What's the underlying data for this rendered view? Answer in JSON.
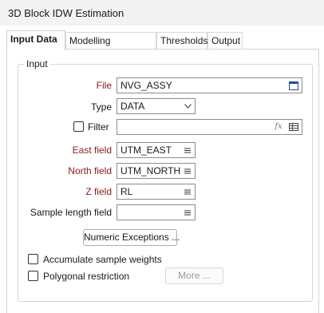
{
  "window": {
    "title": "3D Block IDW Estimation"
  },
  "tabs": [
    {
      "label": "Input Data"
    },
    {
      "label": "Modelling Parameters"
    },
    {
      "label": "Thresholds"
    },
    {
      "label": "Output"
    }
  ],
  "input_group": {
    "legend": "Input",
    "file": {
      "label": "File",
      "value": "NVG_ASSY"
    },
    "type": {
      "label": "Type",
      "value": "DATA"
    },
    "filter": {
      "label": "Filter",
      "value": "",
      "expression_icon": "fx"
    },
    "east_field": {
      "label": "East field",
      "value": "UTM_EAST"
    },
    "north_field": {
      "label": "North field",
      "value": "UTM_NORTH"
    },
    "z_field": {
      "label": "Z field",
      "value": "RL"
    },
    "sample_length_field": {
      "label": "Sample length field",
      "value": ""
    },
    "numeric_exceptions_button": "Numeric Exceptions ...",
    "accumulate_weights": {
      "label": "Accumulate sample weights",
      "checked": false
    },
    "polygonal_restriction": {
      "label": "Polygonal restriction",
      "checked": false
    },
    "more_button": "More ..."
  },
  "colors": {
    "required_label": "#8b1a1a",
    "accent_icon": "#1f4e9c"
  }
}
